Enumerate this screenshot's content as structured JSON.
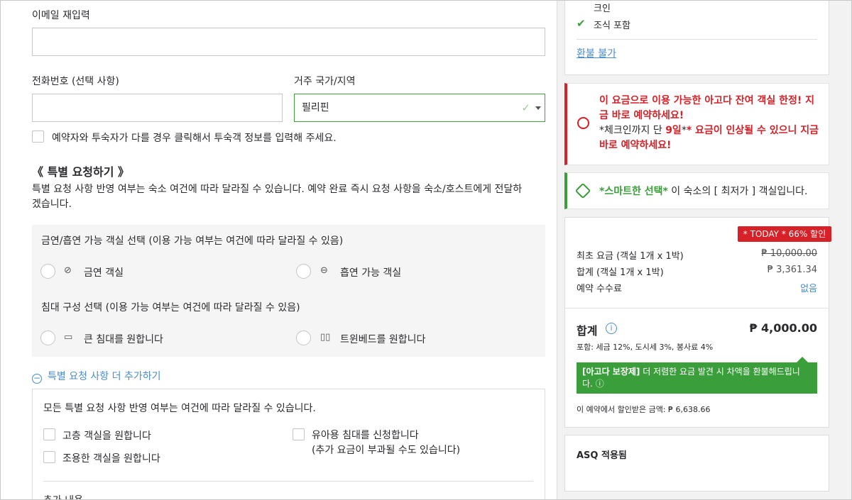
{
  "form": {
    "email_confirm_label": "이메일 재입력",
    "email_confirm_value": "",
    "phone_label": "전화번호 (선택 사항)",
    "phone_value": "",
    "country_label": "거주 국가/지역",
    "country_value": "필리핀",
    "guest_checkbox_label": "예약자와 투숙자가 다를 경우 클릭해서 투숙객 정보를 입력해 주세요."
  },
  "special_requests": {
    "heading": "《 특별 요청하기 》",
    "description_line1": "특별 요청 사항 반영 여부는 숙소 여건에 따라 달라질 수 있습니다. 예약 완료 즉시 요청 사항을 숙소/호스트에게 전달하",
    "description_line2": "겠습니다.",
    "smoking_title": "금연/흡연 가능 객실 선택 (이용 가능 여부는 여건에 따라 달라질 수 있음)",
    "smoking_options": [
      "금연 객실",
      "흡연 가능 객실"
    ],
    "bed_title": "침대 구성 선택 (이용 가능 여부는 여건에 따라 달라질 수 있음)",
    "bed_options": [
      "큰 침대를 원합니다",
      "트윈베드를 원합니다"
    ],
    "add_more_label": "특별 요청 사항 더 추가하기",
    "more_note": "모든 특별 요청 사항 반영 여부는 여건에 따라 달라질 수 있습니다.",
    "more_options": {
      "high_floor": "고층 객실을 원합니다",
      "quiet_room": "조용한 객실을 원합니다",
      "crib_line1": "유아용 침대를 신청합니다",
      "crib_line2": "(추가 요금이 부과될 수도 있습니다)"
    },
    "extra_label": "추가 내용"
  },
  "summary": {
    "features": [
      "크인",
      "조식 포함"
    ],
    "refund_label": "환불 불가",
    "alert_line1": "이 요금으로 이용 가능한 아고다 잔여 객실 한정! 지",
    "alert_line2": "금 바로 예약하세요!",
    "alert_line3_prefix": "*체크인까지 단 ",
    "alert_days": "9일",
    "alert_line3_suffix": "* 요금이 인상될 수 있으니 지금",
    "alert_line4": "바로 예약하세요!",
    "smart_bold": "*스마트한 선택*",
    "smart_rest": " 이 숙소의 [ 최저가 ] 객실입니다.",
    "discount_badge": "* TODAY * 66% 할인",
    "original_label": "최초 요금 (객실 1개 x 1박)",
    "original_value": "₱ 10,000.00",
    "subtotal_label": "합계 (객실 1개 x 1박)",
    "subtotal_value": "₱ 3,361.34",
    "fee_label": "예약 수수료",
    "fee_value": "없음",
    "total_label": "합계",
    "total_value": "₱ 4,000.00",
    "includes": "포함: 세금 12%, 도시세 3%, 봉사료 4%",
    "guarantee_bold": "[아고다 보장제]",
    "guarantee_rest": " 더 저렴한 요금 발견 시 차액을 환불해드립니",
    "guarantee_line2": "다.",
    "saved_text": "이 예약에서 할인받은 금액: ₱ 6,638.66",
    "asq_label": "ASQ 적용됨"
  },
  "colors": {
    "accent_blue": "#4a8ccf",
    "alert_red": "#d52127",
    "success_green": "#3a9e3a"
  },
  "icons": [
    "checkmark-icon",
    "no-smoking-icon",
    "smoking-icon",
    "double-bed-icon",
    "twin-bed-icon",
    "clock-alert-icon",
    "tag-icon",
    "info-icon",
    "minus-circle-icon",
    "chevron-down-icon"
  ]
}
